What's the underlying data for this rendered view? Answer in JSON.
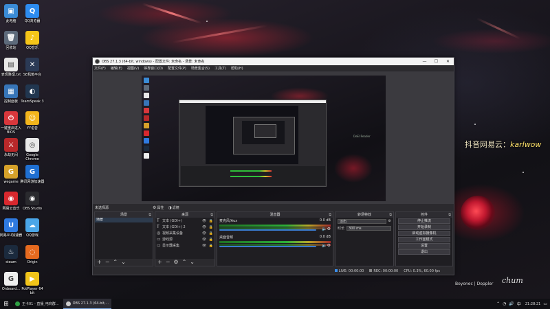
{
  "desktop": {
    "icons_left": [
      {
        "label": "此电脑",
        "color": "#3a8bd6",
        "glyph": "▣",
        "icon": "computer-icon"
      },
      {
        "label": "回收站",
        "color": "#5d6a7a",
        "glyph": "🗑",
        "icon": "recycle-bin-icon"
      },
      {
        "label": "表现整理.txt",
        "color": "#e8e8e8",
        "glyph": "▤",
        "icon": "text-file-icon"
      },
      {
        "label": "控制面板",
        "color": "#3775b8",
        "glyph": "▦",
        "icon": "control-panel-icon"
      },
      {
        "label": "一键重启进入BIOS",
        "color": "#d8373c",
        "glyph": "⏻",
        "icon": "bios-icon"
      },
      {
        "label": "永劫无间",
        "color": "#b8282a",
        "glyph": "⚔",
        "icon": "game-naraka-icon"
      },
      {
        "label": "wegame",
        "color": "#d6a12a",
        "glyph": "G",
        "icon": "wegame-icon"
      },
      {
        "label": "网易云音乐",
        "color": "#d8282e",
        "glyph": "◉",
        "icon": "netease-music-icon"
      },
      {
        "label": "网易UU加速器",
        "color": "#2f7ae0",
        "glyph": "U",
        "icon": "uu-booster-icon"
      },
      {
        "label": "steam",
        "color": "#1b2a3d",
        "glyph": "♨",
        "icon": "steam-icon"
      },
      {
        "label": "Onboard...",
        "color": "#eeeeee",
        "glyph": "G",
        "icon": "onboard-icon"
      }
    ],
    "icons_right": [
      {
        "label": "QQ浏览器",
        "color": "#2d8cf0",
        "glyph": "Q",
        "icon": "qq-browser-icon"
      },
      {
        "label": "QQ音乐",
        "color": "#f5c518",
        "glyph": "♪",
        "icon": "qq-music-icon"
      },
      {
        "label": "SE机箱平台",
        "color": "#2b3a55",
        "glyph": "✕",
        "icon": "se-platform-icon"
      },
      {
        "label": "TeamSpeak 3",
        "color": "#21364f",
        "glyph": "◐",
        "icon": "teamspeak-icon"
      },
      {
        "label": "YY语音",
        "color": "#f2b51c",
        "glyph": "☺",
        "icon": "yy-voice-icon"
      },
      {
        "label": "Google Chrome",
        "color": "#e9e9e9",
        "glyph": "◎",
        "icon": "chrome-icon"
      },
      {
        "label": "腾讯网游加速器",
        "color": "#1f6fd1",
        "glyph": "G",
        "icon": "tencent-booster-icon"
      },
      {
        "label": "OBS Studio",
        "color": "#2a2a2e",
        "glyph": "◉",
        "icon": "obs-icon"
      },
      {
        "label": "QQ游戏",
        "color": "#4aa6e8",
        "glyph": "☁",
        "icon": "qq-game-icon"
      },
      {
        "label": "Origin",
        "color": "#e66a1f",
        "glyph": "◌",
        "icon": "origin-icon"
      },
      {
        "label": "PotPlayer 64 bit",
        "color": "#f1c41a",
        "glyph": "▶",
        "icon": "potplayer-icon"
      }
    ]
  },
  "overlay": {
    "prefix": "抖音网易云：",
    "name": "karlwow",
    "credits": "Boyonec | Doppler",
    "signature": "chum"
  },
  "obs": {
    "title": "OBS 27.1.3 (64-bit, windows) - 配置文件: 未命名 - 场景: 未命名",
    "menu": [
      "文件(F)",
      "编辑(E)",
      "视图(V)",
      "停靠窗口(D)",
      "配置文件(P)",
      "场景集合(S)",
      "工具(T)",
      "帮助(H)"
    ],
    "scene_bar": {
      "current": "未选择源",
      "props_label": "属性",
      "filter_label": "滤镜"
    },
    "docks": {
      "scenes": {
        "title": "场景",
        "items": [
          "场景"
        ]
      },
      "sources": {
        "title": "来源",
        "items": [
          {
            "type": "T",
            "name": "文本 (GDI+)"
          },
          {
            "type": "T",
            "name": "文本 (GDI+) 2"
          },
          {
            "type": "◎",
            "name": "视频采集设备"
          },
          {
            "type": "▭",
            "name": "游戏源"
          },
          {
            "type": "▭",
            "name": "显示器采集"
          }
        ]
      },
      "mixer": {
        "title": "混音器",
        "channels": [
          {
            "name": "麦克风/Aux",
            "db": "0.0 dB"
          },
          {
            "name": "桌面音频",
            "db": "0.0 dB"
          }
        ]
      },
      "transitions": {
        "title": "转场特效",
        "type": "淡出",
        "duration_label": "时长",
        "duration": "300 ms"
      },
      "controls": {
        "title": "控件",
        "buttons": [
          "停止推流",
          "开始录制",
          "启动虚拟摄像机",
          "工作室模式",
          "设置",
          "退出"
        ]
      }
    },
    "status": {
      "live_label": "LIVE:",
      "live_time": "00:00:00",
      "rec_label": "REC:",
      "rec_time": "00:00:00",
      "cpu": "CPU: 0.3%, 60.00 fps"
    }
  },
  "taskbar": {
    "start": "⊞",
    "items": [
      {
        "label": "王卡01 - 直播_电商群...",
        "color": "#2ea043"
      },
      {
        "label": "OBS 27.1.3 (64-bit,...",
        "color": "#cccccc"
      }
    ],
    "clock": "21:28:21"
  }
}
